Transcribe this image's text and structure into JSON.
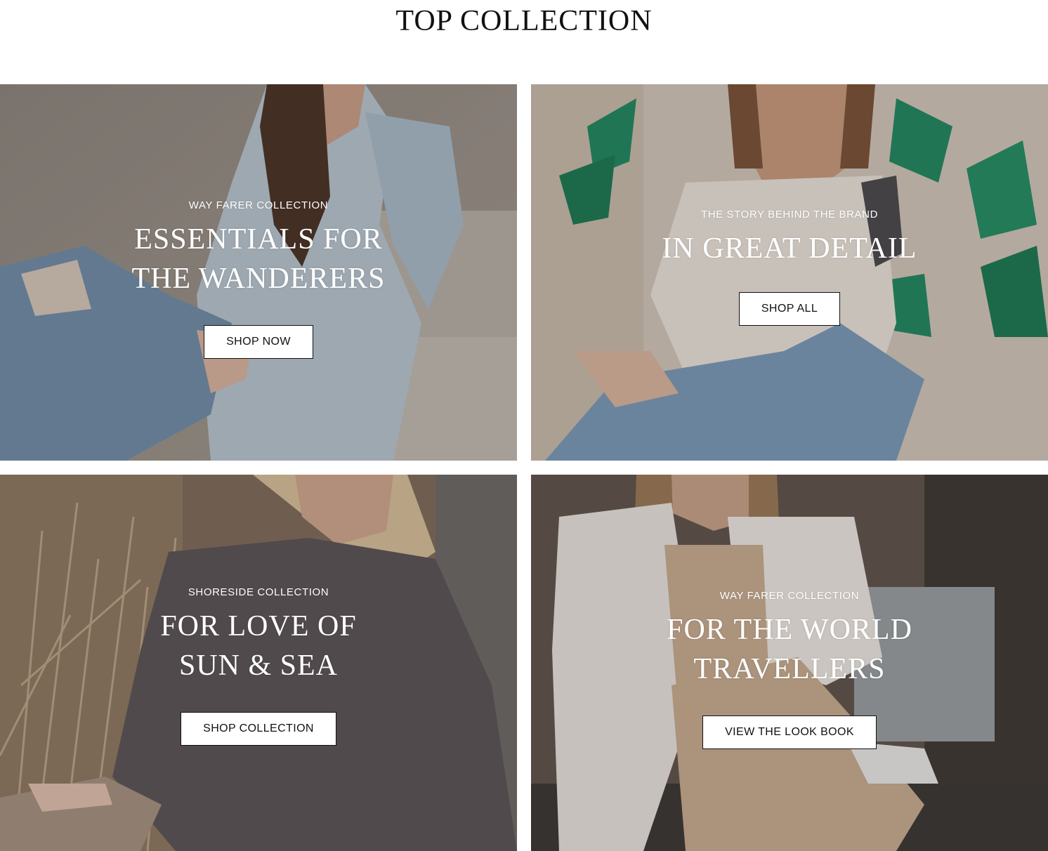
{
  "section": {
    "title": "TOP COLLECTION"
  },
  "cards": [
    {
      "eyebrow": "WAY FARER COLLECTION",
      "headline": "ESSENTIALS FOR THE WANDERERS",
      "button": "SHOP NOW",
      "palette": [
        "#8f8a84",
        "#b9c8d6",
        "#6e8ca8"
      ]
    },
    {
      "eyebrow": "THE STORY BEHIND THE BRAND",
      "headline": "IN GREAT DETAIL",
      "button": "SHOP ALL",
      "palette": [
        "#d6cbbf",
        "#1f8a62",
        "#7a9cbc"
      ]
    },
    {
      "eyebrow": "SHORESIDE COLLECTION",
      "headline": "FOR LOVE OF SUN & SEA",
      "button": "SHOP COLLECTION",
      "palette": [
        "#8a7560",
        "#5b5558",
        "#c9b79d"
      ]
    },
    {
      "eyebrow": "WAY FARER COLLECTION",
      "headline": "FOR THE WORLD TRAVELLERS",
      "button": "VIEW THE LOOK BOOK",
      "palette": [
        "#6b5f55",
        "#e8e4df",
        "#c9ae93"
      ]
    }
  ]
}
